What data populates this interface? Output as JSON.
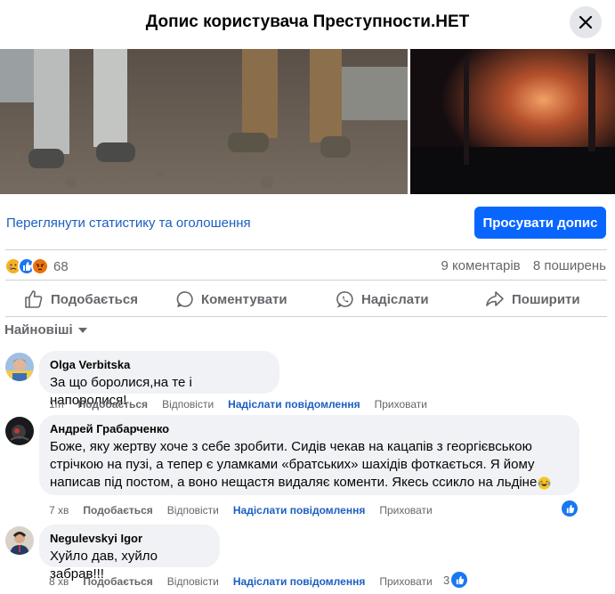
{
  "dialog": {
    "title": "Допис користувача Преступности.НЕТ"
  },
  "post": {
    "stats_link": "Переглянути статистику та оголошення",
    "boost_label": "Просувати допис",
    "reaction_count": "68",
    "comments_count": "9 коментарів",
    "shares_count": "8 поширень"
  },
  "actions": {
    "like": "Подобається",
    "comment": "Коментувати",
    "send": "Надіслати",
    "share": "Поширити"
  },
  "sort": {
    "label": "Найновіші"
  },
  "comments": [
    {
      "author": "Olga Verbitska",
      "text": "За що боролися,на те і напоролися!",
      "time": "1m",
      "like": "Подобається",
      "reply": "Відповісти",
      "message": "Надіслати повідомлення",
      "hide": "Приховати"
    },
    {
      "author": "Андрей Грабарченко",
      "text_lines": [
        "Боже, яку жертву хоче з себе зробити. Сидів чекав на кацапів з георгієвською",
        "стрічкою на пузі, а тепер є уламками «братських» шахідів фоткається. Я йому",
        "написав під постом, а воно нещастя видаляє коменти. Якесь ссикло на льдіне"
      ],
      "time": "7 хв",
      "like": "Подобається",
      "reply": "Відповісти",
      "message": "Надіслати повідомлення",
      "hide": "Приховати"
    },
    {
      "author": "Negulevskyi Igor",
      "text": "Хуйло дав, хуйло забрав!!!",
      "time": "8 хв",
      "like": "Подобається",
      "reply": "Відповісти",
      "message": "Надіслати повідомлення",
      "hide": "Приховати",
      "likes": "3"
    }
  ],
  "colors": {
    "accent": "#0866ff",
    "link": "#1b5fc2",
    "bubble": "#f0f2f5",
    "secondary_text": "#65676b"
  }
}
